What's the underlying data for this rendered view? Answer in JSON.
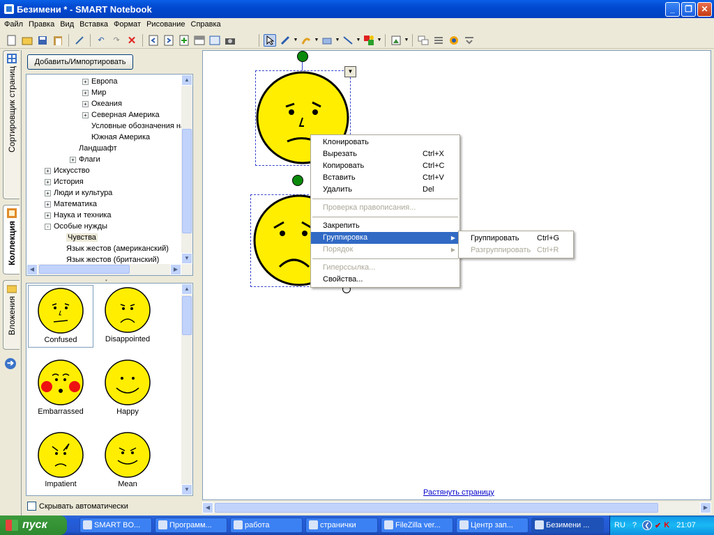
{
  "window": {
    "title": "Безимени * - SMART Notebook"
  },
  "menubar": [
    "Файл",
    "Правка",
    "Вид",
    "Вставка",
    "Формат",
    "Рисование",
    "Справка"
  ],
  "sidetabs": {
    "sorter": "Сортировщик страниц",
    "gallery": "Коллекция",
    "attachments": "Вложения"
  },
  "gallery": {
    "add_button": "Добавить/Импортировать",
    "tree": [
      {
        "label": "Европа",
        "indent": 4,
        "expander": "+"
      },
      {
        "label": "Мир",
        "indent": 4,
        "expander": "+"
      },
      {
        "label": "Океания",
        "indent": 4,
        "expander": "+"
      },
      {
        "label": "Северная Америка",
        "indent": 4,
        "expander": "+"
      },
      {
        "label": "Условные обозначения на к",
        "indent": 4,
        "expander": ""
      },
      {
        "label": "Южная Америка",
        "indent": 4,
        "expander": ""
      },
      {
        "label": "Ландшафт",
        "indent": 3,
        "expander": ""
      },
      {
        "label": "Флаги",
        "indent": 3,
        "expander": "+"
      },
      {
        "label": "Искусство",
        "indent": 1,
        "expander": "+"
      },
      {
        "label": "История",
        "indent": 1,
        "expander": "+"
      },
      {
        "label": "Люди и культура",
        "indent": 1,
        "expander": "+"
      },
      {
        "label": "Математика",
        "indent": 1,
        "expander": "+"
      },
      {
        "label": "Наука и техника",
        "indent": 1,
        "expander": "+"
      },
      {
        "label": "Особые нужды",
        "indent": 1,
        "expander": "-"
      },
      {
        "label": "Чувства",
        "indent": 2,
        "expander": "",
        "selected": true
      },
      {
        "label": "Язык жестов (американский)",
        "indent": 2,
        "expander": ""
      },
      {
        "label": "Язык жестов (британский)",
        "indent": 2,
        "expander": ""
      }
    ],
    "thumbnails": [
      {
        "label": "Confused",
        "face": "confused"
      },
      {
        "label": "Disappointed",
        "face": "disappointed"
      },
      {
        "label": "Embarrassed",
        "face": "embarrassed"
      },
      {
        "label": "Happy",
        "face": "happy"
      },
      {
        "label": "Impatient",
        "face": "impatient"
      },
      {
        "label": "Mean",
        "face": "mean"
      }
    ],
    "autohide": "Скрывать автоматически"
  },
  "canvas": {
    "extend_link": "Растянуть страницу"
  },
  "context_menu": {
    "items": [
      {
        "label": "Клонировать",
        "shortcut": "",
        "disabled": false
      },
      {
        "label": "Вырезать",
        "shortcut": "Ctrl+X",
        "disabled": false
      },
      {
        "label": "Копировать",
        "shortcut": "Ctrl+C",
        "disabled": false
      },
      {
        "label": "Вставить",
        "shortcut": "Ctrl+V",
        "disabled": false
      },
      {
        "label": "Удалить",
        "shortcut": "Del",
        "disabled": false
      },
      {
        "sep": true
      },
      {
        "label": "Проверка правописания...",
        "shortcut": "",
        "disabled": true
      },
      {
        "sep": true
      },
      {
        "label": "Закрепить",
        "shortcut": "",
        "disabled": false
      },
      {
        "label": "Группировка",
        "shortcut": "",
        "disabled": false,
        "highlighted": true,
        "submenu": true
      },
      {
        "label": "Порядок",
        "shortcut": "",
        "disabled": true,
        "submenu": true
      },
      {
        "sep": true
      },
      {
        "label": "Гиперссылка...",
        "shortcut": "",
        "disabled": true
      },
      {
        "label": "Свойства...",
        "shortcut": "",
        "disabled": false
      }
    ],
    "submenu": [
      {
        "label": "Группировать",
        "shortcut": "Ctrl+G",
        "disabled": false
      },
      {
        "label": "Разгруппировать",
        "shortcut": "Ctrl+R",
        "disabled": true
      }
    ]
  },
  "taskbar": {
    "start": "пуск",
    "tasks": [
      {
        "label": "SMART BO...",
        "active": false
      },
      {
        "label": "Программ...",
        "active": false
      },
      {
        "label": "работа",
        "active": false
      },
      {
        "label": "странички",
        "active": false
      },
      {
        "label": "FileZilla ver...",
        "active": false
      },
      {
        "label": "Центр зап...",
        "active": false
      },
      {
        "label": "Безимени ...",
        "active": true
      }
    ],
    "lang": "RU",
    "time": "21:07"
  }
}
